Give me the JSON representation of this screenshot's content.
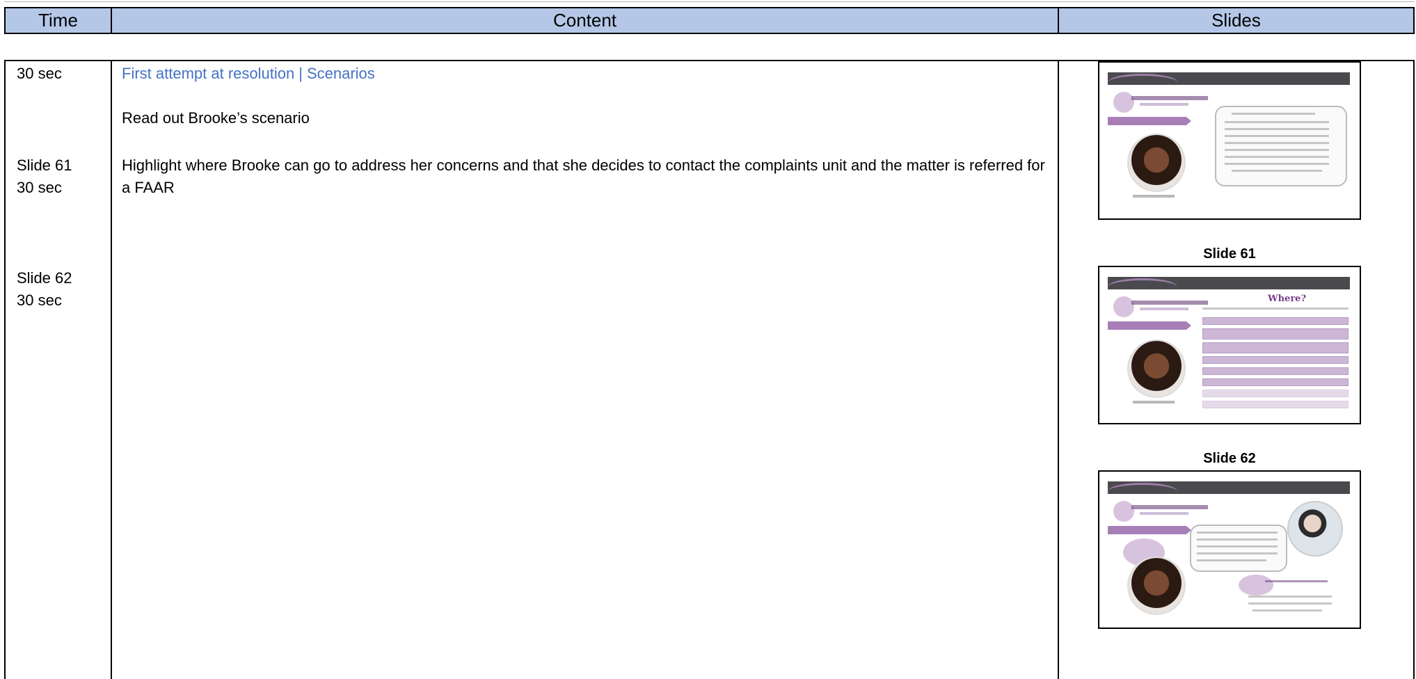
{
  "header": {
    "time": "Time",
    "content": "Content",
    "slides": "Slides"
  },
  "time_column": [
    "30 sec",
    "Slide 61",
    "30 sec",
    "Slide 62",
    "30 sec"
  ],
  "content": {
    "section_link": "First attempt at resolution",
    "section_separator": "|",
    "section_sub": "Scenarios",
    "line1": "Read out Brooke’s scenario",
    "line2": "Highlight where Brooke can go to address her concerns and that she decides to contact the complaints unit and the matter is referred for a FAAR"
  },
  "slides": {
    "label_61": "Slide 61",
    "label_62": "Slide 62",
    "thumb2_heading": "Where?"
  }
}
